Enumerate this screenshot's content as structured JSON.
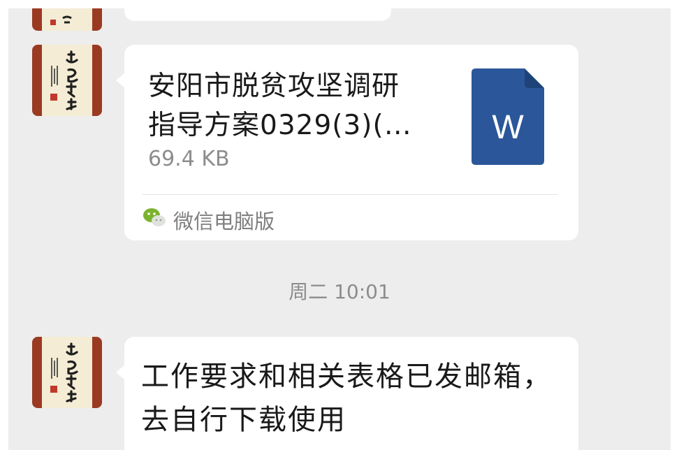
{
  "messages": [
    {
      "type": "file",
      "file_name": "安阳市脱贫攻坚调研\n指导方案0329(3)(…",
      "file_size": "69.4 KB",
      "file_icon_letter": "W",
      "file_icon_color": "#2b579a",
      "source_label": "微信电脑版",
      "source_icon": "wechat-icon"
    },
    {
      "type": "timestamp",
      "text": "周二 10:01"
    },
    {
      "type": "text",
      "text": "工作要求和相关表格已发邮箱，\n去自行下载使用"
    }
  ],
  "colors": {
    "chat_background": "#ededed",
    "bubble": "#ffffff",
    "word_blue": "#2b579a"
  }
}
